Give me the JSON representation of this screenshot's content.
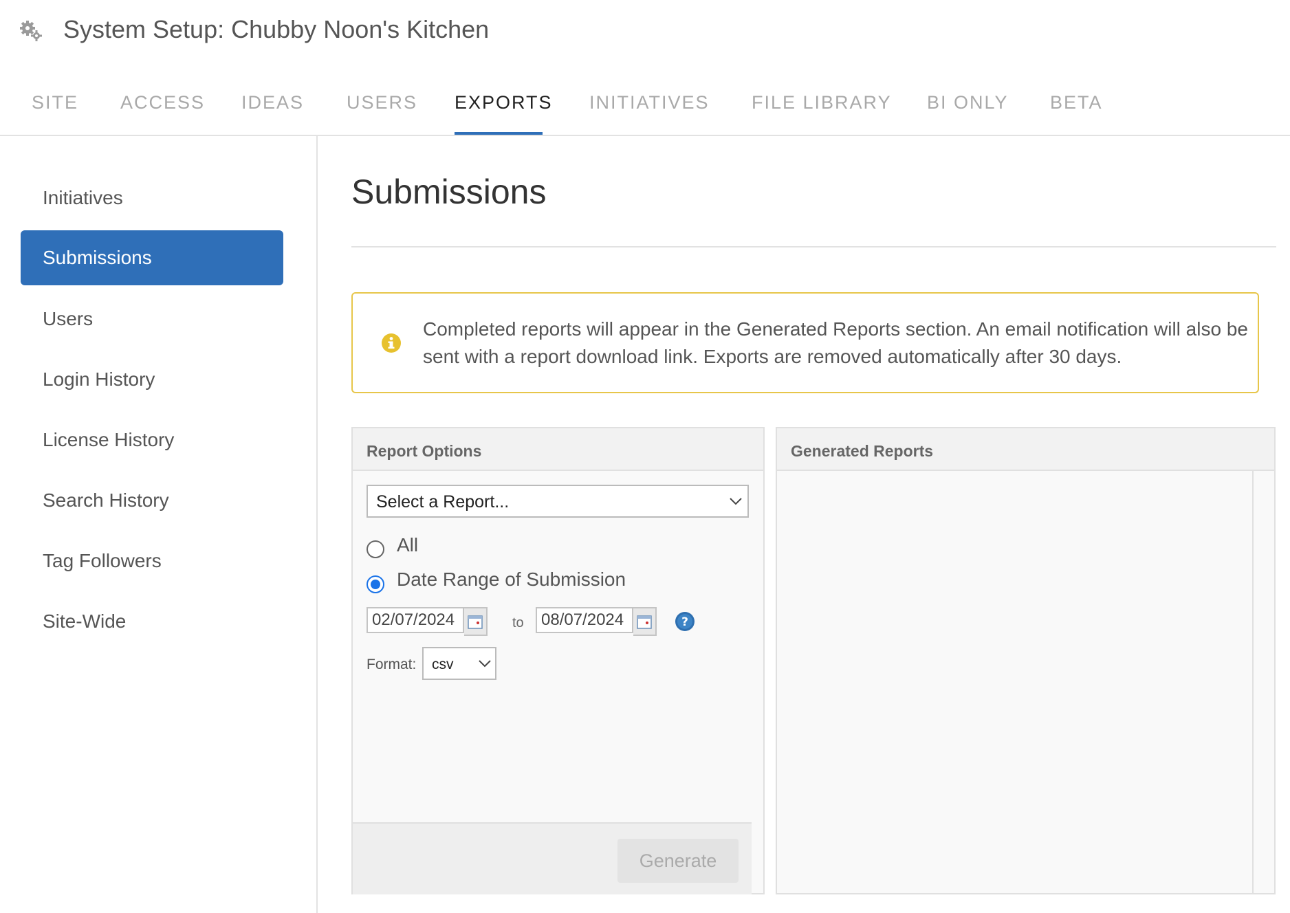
{
  "header": {
    "icon": "gears-icon",
    "title": "System Setup: Chubby Noon's Kitchen"
  },
  "tabs": [
    {
      "label": "SITE"
    },
    {
      "label": "ACCESS"
    },
    {
      "label": "IDEAS"
    },
    {
      "label": "USERS"
    },
    {
      "label": "EXPORTS",
      "active": true
    },
    {
      "label": "INITIATIVES"
    },
    {
      "label": "FILE LIBRARY"
    },
    {
      "label": "BI ONLY"
    },
    {
      "label": "BETA"
    }
  ],
  "sidebar": {
    "items": [
      {
        "label": "Initiatives"
      },
      {
        "label": "Submissions",
        "active": true
      },
      {
        "label": "Users"
      },
      {
        "label": "Login History"
      },
      {
        "label": "License History"
      },
      {
        "label": "Search History"
      },
      {
        "label": "Tag Followers"
      },
      {
        "label": "Site-Wide"
      }
    ]
  },
  "main": {
    "title": "Submissions",
    "notice": {
      "icon": "info-icon",
      "text": "Completed reports will appear in the Generated Reports section. An email notification will also be sent with a report download link. Exports are removed automatically after 30 days."
    },
    "report_options": {
      "heading": "Report Options",
      "select_report": "Select a Report...",
      "radio_all": "All",
      "radio_date_range": "Date Range of Submission",
      "selected_radio": "Date Range of Submission",
      "date_from": "02/07/2024",
      "to_label": "to",
      "date_to": "08/07/2024",
      "format_label": "Format:",
      "format_value": "csv",
      "generate_label": "Generate"
    },
    "generated_reports": {
      "heading": "Generated Reports"
    }
  },
  "colors": {
    "accent": "#2f6fb8",
    "notice_border": "#e7c64a",
    "radio_selected": "#1a73e8"
  }
}
